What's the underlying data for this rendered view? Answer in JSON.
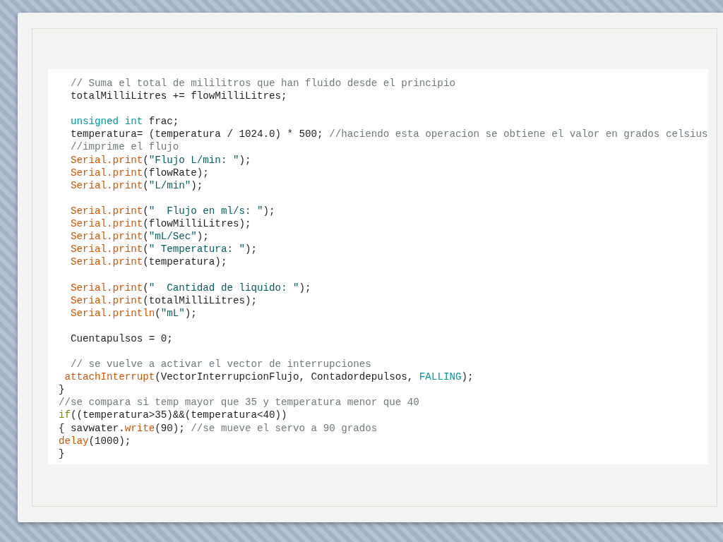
{
  "code_lines": [
    {
      "kind": "code",
      "tokens": [
        {
          "kind": "comment",
          "text": "  // Suma el total de mililitros que han fluido desde el principio"
        }
      ]
    },
    {
      "kind": "code",
      "tokens": [
        {
          "kind": "plain",
          "text": "  totalMilliLitres += flowMilliLitres;"
        }
      ]
    },
    {
      "kind": "blank"
    },
    {
      "kind": "code",
      "tokens": [
        {
          "kind": "type",
          "text": "  unsigned int"
        },
        {
          "kind": "plain",
          "text": " frac;"
        }
      ]
    },
    {
      "kind": "code",
      "tokens": [
        {
          "kind": "plain",
          "text": "  temperatura= (temperatura / 1024.0) * 500; "
        },
        {
          "kind": "comment",
          "text": "//haciendo esta operacion se obtiene el valor en grados celsius"
        }
      ]
    },
    {
      "kind": "code",
      "tokens": [
        {
          "kind": "comment",
          "text": "  //imprime el flujo"
        }
      ]
    },
    {
      "kind": "code",
      "tokens": [
        {
          "kind": "function",
          "text": "  Serial.print"
        },
        {
          "kind": "plain",
          "text": "("
        },
        {
          "kind": "string",
          "text": "\"Flujo L/min: \""
        },
        {
          "kind": "plain",
          "text": ");"
        }
      ]
    },
    {
      "kind": "code",
      "tokens": [
        {
          "kind": "function",
          "text": "  Serial.print"
        },
        {
          "kind": "plain",
          "text": "(flowRate);"
        }
      ]
    },
    {
      "kind": "code",
      "tokens": [
        {
          "kind": "function",
          "text": "  Serial.print"
        },
        {
          "kind": "plain",
          "text": "("
        },
        {
          "kind": "string",
          "text": "\"L/min\""
        },
        {
          "kind": "plain",
          "text": ");"
        }
      ]
    },
    {
      "kind": "blank"
    },
    {
      "kind": "code",
      "tokens": [
        {
          "kind": "function",
          "text": "  Serial.print"
        },
        {
          "kind": "plain",
          "text": "("
        },
        {
          "kind": "string",
          "text": "\"  Flujo en ml/s: \""
        },
        {
          "kind": "plain",
          "text": ");"
        }
      ]
    },
    {
      "kind": "code",
      "tokens": [
        {
          "kind": "function",
          "text": "  Serial.print"
        },
        {
          "kind": "plain",
          "text": "(flowMilliLitres);"
        }
      ]
    },
    {
      "kind": "code",
      "tokens": [
        {
          "kind": "function",
          "text": "  Serial.print"
        },
        {
          "kind": "plain",
          "text": "("
        },
        {
          "kind": "string",
          "text": "\"mL/Sec\""
        },
        {
          "kind": "plain",
          "text": ");"
        }
      ]
    },
    {
      "kind": "code",
      "tokens": [
        {
          "kind": "function",
          "text": "  Serial.print"
        },
        {
          "kind": "plain",
          "text": "("
        },
        {
          "kind": "string",
          "text": "\" Temperatura: \""
        },
        {
          "kind": "plain",
          "text": ");"
        }
      ]
    },
    {
      "kind": "code",
      "tokens": [
        {
          "kind": "function",
          "text": "  Serial.print"
        },
        {
          "kind": "plain",
          "text": "(temperatura);"
        }
      ]
    },
    {
      "kind": "blank"
    },
    {
      "kind": "code",
      "tokens": [
        {
          "kind": "function",
          "text": "  Serial.print"
        },
        {
          "kind": "plain",
          "text": "("
        },
        {
          "kind": "string",
          "text": "\"  Cantidad de liquido: \""
        },
        {
          "kind": "plain",
          "text": ");"
        }
      ]
    },
    {
      "kind": "code",
      "tokens": [
        {
          "kind": "function",
          "text": "  Serial.print"
        },
        {
          "kind": "plain",
          "text": "(totalMilliLitres);"
        }
      ]
    },
    {
      "kind": "code",
      "tokens": [
        {
          "kind": "function",
          "text": "  Serial.println"
        },
        {
          "kind": "plain",
          "text": "("
        },
        {
          "kind": "string",
          "text": "\"mL\""
        },
        {
          "kind": "plain",
          "text": ");"
        }
      ]
    },
    {
      "kind": "blank"
    },
    {
      "kind": "code",
      "tokens": [
        {
          "kind": "plain",
          "text": "  Cuentapulsos = 0;"
        }
      ]
    },
    {
      "kind": "blank"
    },
    {
      "kind": "code",
      "tokens": [
        {
          "kind": "comment",
          "text": "  // se vuelve a activar el vector de interrupciones"
        }
      ]
    },
    {
      "kind": "code",
      "tokens": [
        {
          "kind": "function",
          "text": " attachInterrupt"
        },
        {
          "kind": "plain",
          "text": "(VectorInterrupcionFlujo, Contadordepulsos, "
        },
        {
          "kind": "constant",
          "text": "FALLING"
        },
        {
          "kind": "plain",
          "text": ");"
        }
      ]
    },
    {
      "kind": "code",
      "tokens": [
        {
          "kind": "plain",
          "text": "}"
        }
      ]
    },
    {
      "kind": "code",
      "tokens": [
        {
          "kind": "comment",
          "text": "//se compara si temp mayor que 35 y temperatura menor que 40"
        }
      ]
    },
    {
      "kind": "code",
      "tokens": [
        {
          "kind": "control",
          "text": "if"
        },
        {
          "kind": "plain",
          "text": "((temperatura>35)&&(temperatura<40))"
        }
      ]
    },
    {
      "kind": "code",
      "tokens": [
        {
          "kind": "plain",
          "text": "{ savwater."
        },
        {
          "kind": "function",
          "text": "write"
        },
        {
          "kind": "plain",
          "text": "(90); "
        },
        {
          "kind": "comment",
          "text": "//se mueve el servo a 90 grados"
        }
      ]
    },
    {
      "kind": "code",
      "tokens": [
        {
          "kind": "function",
          "text": "delay"
        },
        {
          "kind": "plain",
          "text": "(1000);"
        }
      ]
    },
    {
      "kind": "code",
      "tokens": [
        {
          "kind": "plain",
          "text": "}"
        }
      ]
    }
  ]
}
